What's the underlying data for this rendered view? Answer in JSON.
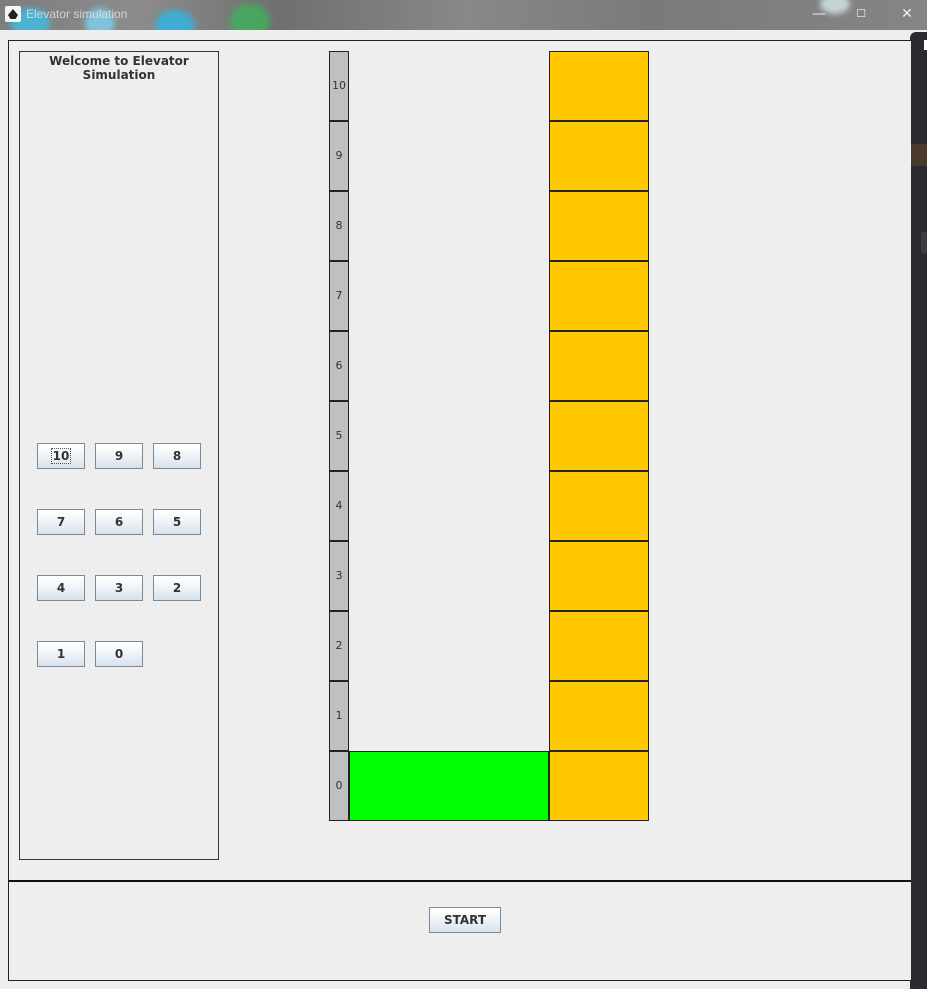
{
  "window": {
    "title": "Elevator simulation",
    "minimize": "—",
    "maximize": "☐",
    "close": "✕"
  },
  "panel": {
    "title": "Welcome to Elevator Simulation",
    "buttons": [
      {
        "label": "10",
        "focused": true
      },
      {
        "label": "9"
      },
      {
        "label": "8"
      },
      {
        "label": "7"
      },
      {
        "label": "6"
      },
      {
        "label": "5"
      },
      {
        "label": "4"
      },
      {
        "label": "3"
      },
      {
        "label": "2"
      },
      {
        "label": "1"
      },
      {
        "label": "0"
      }
    ]
  },
  "shaft": {
    "floors": [
      "10",
      "9",
      "8",
      "7",
      "6",
      "5",
      "4",
      "3",
      "2",
      "1",
      "0"
    ],
    "current_floor": "0",
    "colors": {
      "floor": "#ffc800",
      "car": "#00ff00",
      "label_bg": "#c0c0c0"
    }
  },
  "controls": {
    "start_label": "START"
  }
}
